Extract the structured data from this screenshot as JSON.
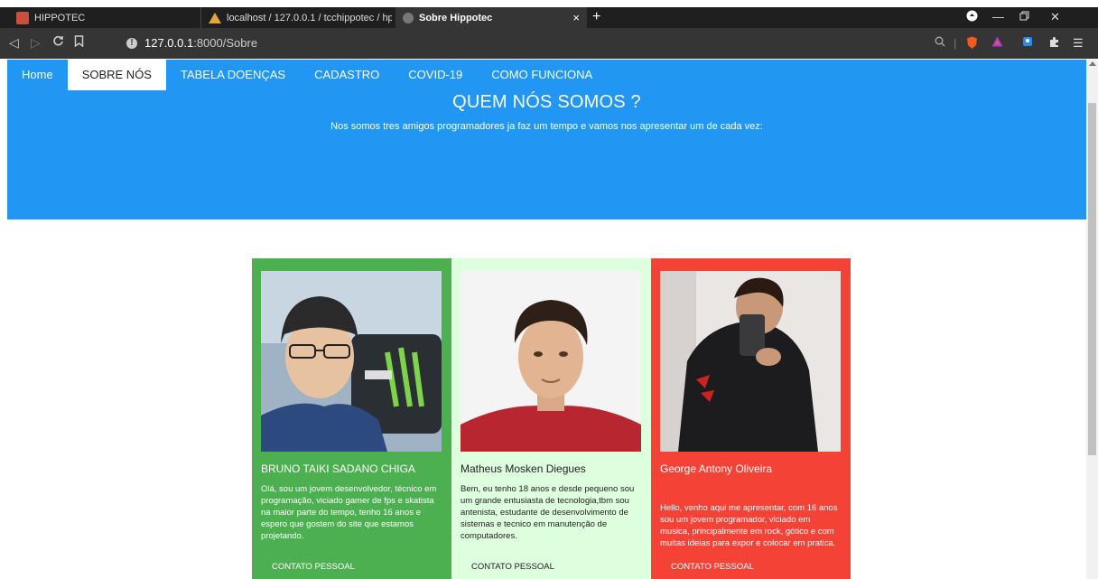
{
  "browser": {
    "tabs": [
      {
        "label": "HIPPOTEC"
      },
      {
        "label": "localhost / 127.0.0.1 / tcchippotec / hp"
      },
      {
        "label": "Sobre Hippotec",
        "active": true
      }
    ],
    "new_tab": "+",
    "close_tab": "×",
    "address": {
      "host": "127.0.0.1",
      "rest": ":8000/Sobre"
    }
  },
  "nav": {
    "items": [
      {
        "label": "Home"
      },
      {
        "label": "SOBRE NÓS",
        "active": true
      },
      {
        "label": "TABELA DOENÇAS"
      },
      {
        "label": "CADASTRO"
      },
      {
        "label": "COVID-19"
      },
      {
        "label": "COMO FUNCIONA"
      }
    ]
  },
  "hero": {
    "title": "QUEM NÓS SOMOS ?",
    "subtitle": "Nos somos tres amigos programadores ja faz um tempo e vamos nos apresentar um de cada vez:"
  },
  "cards": [
    {
      "name": "BRUNO TAIKI SADANO CHIGA",
      "bio": "Olá, sou um jovem desenvolvedor, técnico em programação, viciado gamer de fps e skatista na maior parte do tempo, tenho 16 anos e espero que gostem do site que estamos projetando.",
      "contact": "CONTATO PESSOAL",
      "color": "#4caf50"
    },
    {
      "name": "Matheus Mosken Diegues",
      "bio": "Bem, eu tenho 18 anos e desde pequeno sou um grande entusiasta de tecnologia,tbm sou antenista, estudante de desenvolvimento de sistemas e tecnico em manutenção de computadores.",
      "contact": "CONTATO PESSOAL",
      "color": "#ddffdd"
    },
    {
      "name": "George Antony Oliveira",
      "bio": "Hello, venho aqui me apresentar, com 16 anos sou um jovem programador, viciado em musica, principalmente em rock, gótico e com muitas ideias para expor e colocar em pratica.",
      "contact": "CONTATO PESSOAL",
      "color": "#f44336"
    }
  ]
}
